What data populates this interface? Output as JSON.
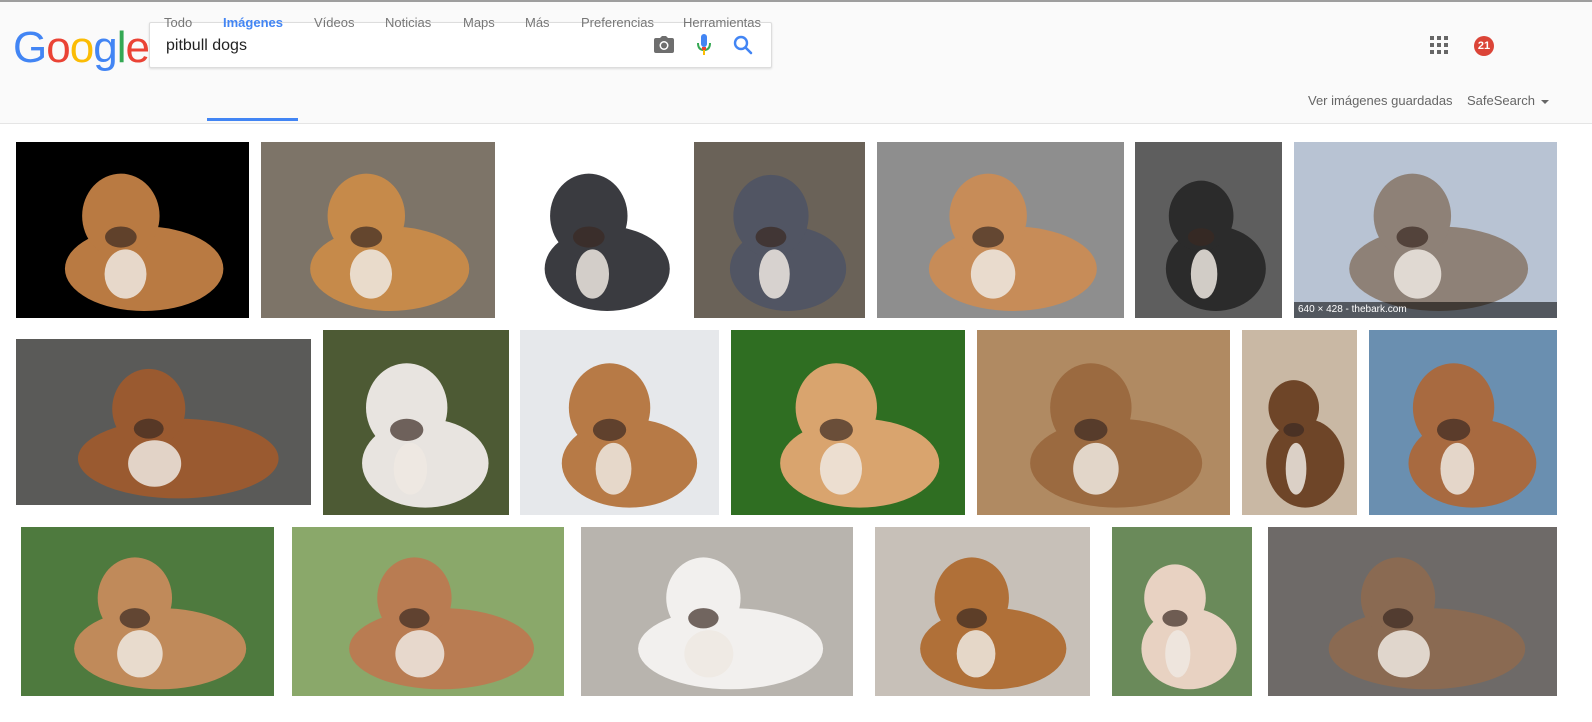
{
  "logo": {
    "letters": [
      "G",
      "o",
      "o",
      "g",
      "l",
      "e"
    ],
    "colors": [
      "#4285f4",
      "#ea4335",
      "#fbbc05",
      "#4285f4",
      "#34a853",
      "#ea4335"
    ]
  },
  "search": {
    "query": "pitbull dogs",
    "camera_icon": "camera-icon",
    "mic_icon": "microphone-icon",
    "search_icon": "search-icon"
  },
  "tabs": [
    "Todo",
    "Imágenes",
    "Vídeos",
    "Noticias",
    "Maps",
    "Más",
    "Preferencias",
    "Herramientas"
  ],
  "active_tab": "Imágenes",
  "right": {
    "saved_images": "Ver imágenes guardadas",
    "safesearch": "SafeSearch"
  },
  "notifications": {
    "count": "21"
  },
  "colors": {
    "accent": "#4285f4",
    "badge": "#db4437"
  },
  "results": {
    "hover_caption": "640 × 428 - thebark.com",
    "images": [
      {
        "name": "pitbull-image-1",
        "bg": "#000",
        "dog": "#b97a42"
      },
      {
        "name": "pitbull-image-2",
        "bg": "#7d7468",
        "dog": "#c68a4a"
      },
      {
        "name": "pitbull-image-3",
        "bg": "#fff",
        "dog": "#3a3b40"
      },
      {
        "name": "pitbull-image-4",
        "bg": "#6a6258",
        "dog": "#515563"
      },
      {
        "name": "pitbull-image-5",
        "bg": "#8e8e8e",
        "dog": "#c78c58"
      },
      {
        "name": "pitbull-image-6",
        "bg": "#5e5e5e",
        "dog": "#2b2b2b"
      },
      {
        "name": "pitbull-image-7",
        "bg": "#b8c3d3",
        "dog": "#8e8177"
      },
      {
        "name": "pitbull-image-8",
        "bg": "#5a5a58",
        "dog": "#9a5a30"
      },
      {
        "name": "pitbull-image-9",
        "bg": "#4d5a34",
        "dog": "#e8e4e0"
      },
      {
        "name": "pitbull-image-10",
        "bg": "#e6e8eb",
        "dog": "#b77a46"
      },
      {
        "name": "pitbull-image-11",
        "bg": "#2f6e22",
        "dog": "#d9a46e"
      },
      {
        "name": "pitbull-image-12",
        "bg": "#b08a62",
        "dog": "#9b6a40"
      },
      {
        "name": "pitbull-image-13",
        "bg": "#c9b8a4",
        "dog": "#6e4528"
      },
      {
        "name": "pitbull-image-14",
        "bg": "#6a8fb0",
        "dog": "#a86a40"
      },
      {
        "name": "pitbull-image-15",
        "bg": "#4e7a3e",
        "dog": "#c08a5a"
      },
      {
        "name": "pitbull-image-16",
        "bg": "#8aa86a",
        "dog": "#b97c52"
      },
      {
        "name": "pitbull-image-17",
        "bg": "#b8b4ae",
        "dog": "#f2f0ee"
      },
      {
        "name": "pitbull-image-18",
        "bg": "#c7c0b8",
        "dog": "#b07038"
      },
      {
        "name": "pitbull-image-19",
        "bg": "#6a8a5a",
        "dog": "#e8d2c2"
      },
      {
        "name": "pitbull-image-20",
        "bg": "#6e6a68",
        "dog": "#8a6a52"
      }
    ]
  }
}
